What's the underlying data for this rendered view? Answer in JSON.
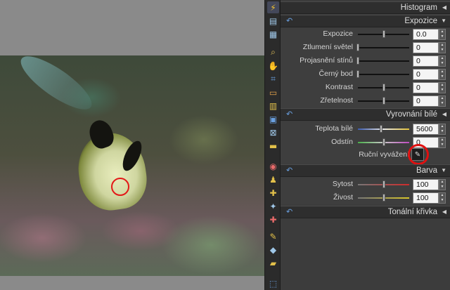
{
  "panels": {
    "histogram": {
      "title": "Histogram"
    },
    "exposure": {
      "title": "Expozice",
      "rows": [
        {
          "label": "Expozice",
          "value": "0.0",
          "level": 0.5
        },
        {
          "label": "Ztlumení světel",
          "value": "0",
          "level": 0.0
        },
        {
          "label": "Projasnění stínů",
          "value": "0",
          "level": 0.0
        },
        {
          "label": "Černý bod",
          "value": "0",
          "level": 0.0
        },
        {
          "label": "Kontrast",
          "value": "0",
          "level": 0.5
        },
        {
          "label": "Zřetelnost",
          "value": "0",
          "level": 0.5
        }
      ]
    },
    "white_balance": {
      "title": "Vyrovnání bílé",
      "rows": [
        {
          "label": "Teplota bílé",
          "value": "5600",
          "level": 0.45
        },
        {
          "label": "Odstín",
          "value": "0",
          "level": 0.5
        }
      ],
      "picker_label": "Ruční vyvážení"
    },
    "color": {
      "title": "Barva",
      "rows": [
        {
          "label": "Sytost",
          "value": "100",
          "level": 0.5
        },
        {
          "label": "Živost",
          "value": "100",
          "level": 0.5
        }
      ]
    },
    "tone_curve": {
      "title": "Tonální křivka"
    }
  },
  "toolbar": {
    "icons": [
      "lightning-icon",
      "print-icon",
      "calculator-icon",
      "zoom-icon",
      "hand-icon",
      "crop-icon",
      "level-icon",
      "straighten-icon",
      "transform-icon",
      "perspective-icon",
      "gradient-icon",
      "redeye-icon",
      "clone-icon",
      "heal-icon",
      "magic-wand-icon",
      "add-mask-icon",
      "brush-icon",
      "fill-icon",
      "eraser-icon",
      "selection-icon"
    ]
  },
  "colors": {
    "accent_undo": "#6aa0e0",
    "marker_red": "#e31818"
  }
}
